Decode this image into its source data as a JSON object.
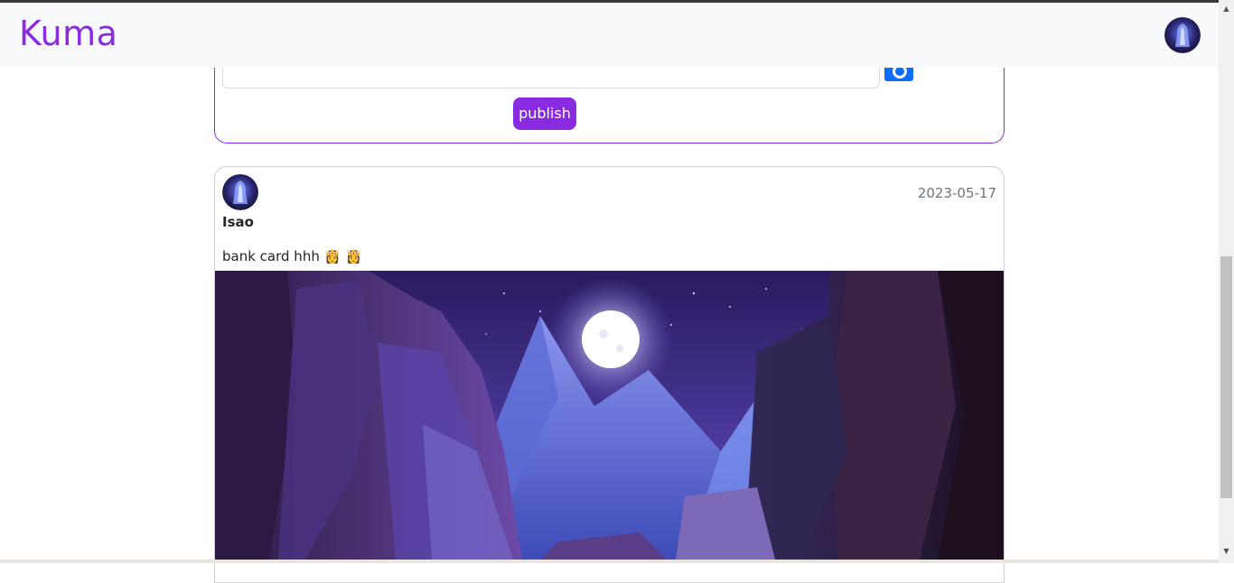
{
  "app": {
    "brand": "Kuma",
    "brand_color": "#8a2be2"
  },
  "navbar": {
    "avatar_icon": "ghost-avatar-icon"
  },
  "composer": {
    "input_value": "",
    "camera_icon": "camera-icon",
    "publish_label": "publish"
  },
  "post": {
    "author": "Isao",
    "date": "2023-05-17",
    "text": "bank card hhh 👸 👸",
    "image": "night-canyon-moon-image"
  },
  "colors": {
    "accent": "#8a2be2",
    "primary": "#0d6efd",
    "muted": "#6c757d"
  }
}
